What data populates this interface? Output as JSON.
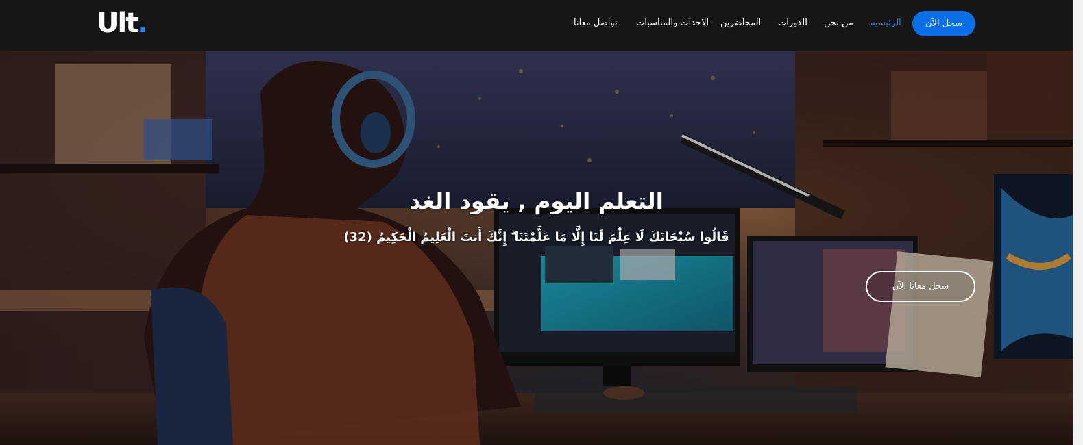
{
  "header": {
    "logo_text": "Ult",
    "logo_dot": ".",
    "nav": [
      {
        "label": "الرئيسيه",
        "active": true
      },
      {
        "label": "من نحن",
        "active": false
      },
      {
        "label": "الدورات",
        "active": false
      },
      {
        "label": "المحاضرين",
        "active": false
      },
      {
        "label": "الاحداث والمناسبات",
        "active": false
      },
      {
        "label": "تواصل معانا",
        "active": false
      }
    ],
    "cta_label": "سجل الآن"
  },
  "hero": {
    "title": "التعلم اليوم , يقود الغد",
    "subtitle": "قَالُوا سُبْحَانَكَ لَا عِلْمَ لَنَا إِلَّا مَا عَلَّمْتَنَا ۖ إِنَّكَ أَنتَ الْعَلِيمُ الْحَكِيمُ (32)",
    "cta_label": "سجل معانا الآن"
  },
  "colors": {
    "accent": "#0b6fe8",
    "navbar_bg": "#161616"
  }
}
